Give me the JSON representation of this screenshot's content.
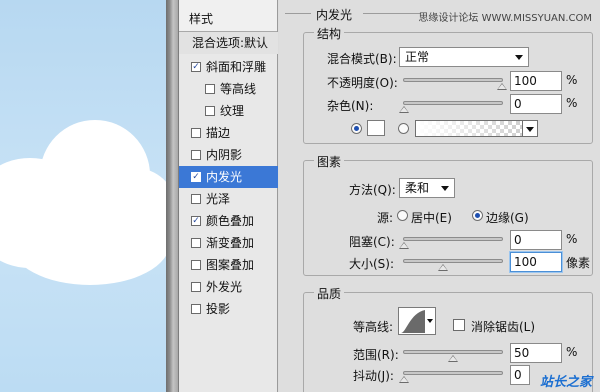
{
  "styles_panel": {
    "header": "样式",
    "blend_options": "混合选项:默认",
    "items": [
      {
        "label": "斜面和浮雕",
        "checked": true,
        "indent": false,
        "selected": false
      },
      {
        "label": "等高线",
        "checked": false,
        "indent": true,
        "selected": false
      },
      {
        "label": "纹理",
        "checked": false,
        "indent": true,
        "selected": false
      },
      {
        "label": "描边",
        "checked": false,
        "indent": false,
        "selected": false
      },
      {
        "label": "内阴影",
        "checked": false,
        "indent": false,
        "selected": false
      },
      {
        "label": "内发光",
        "checked": true,
        "indent": false,
        "selected": true
      },
      {
        "label": "光泽",
        "checked": false,
        "indent": false,
        "selected": false
      },
      {
        "label": "颜色叠加",
        "checked": true,
        "indent": false,
        "selected": false
      },
      {
        "label": "渐变叠加",
        "checked": false,
        "indent": false,
        "selected": false
      },
      {
        "label": "图案叠加",
        "checked": false,
        "indent": false,
        "selected": false
      },
      {
        "label": "外发光",
        "checked": false,
        "indent": false,
        "selected": false
      },
      {
        "label": "投影",
        "checked": false,
        "indent": false,
        "selected": false
      }
    ]
  },
  "panel": {
    "title": "内发光",
    "watermark_top": "思缘设计论坛 WWW.MISSYUAN.COM",
    "structure": {
      "legend": "结构",
      "blend_mode_label": "混合模式(B):",
      "blend_mode_value": "正常",
      "opacity_label": "不透明度(O):",
      "opacity_value": "100",
      "opacity_unit": "%",
      "opacity_level": 1.0,
      "noise_label": "杂色(N):",
      "noise_value": "0",
      "noise_unit": "%",
      "noise_level": 0.0
    },
    "elements": {
      "legend": "图素",
      "method_label": "方法(Q):",
      "method_value": "柔和",
      "source_label": "源:",
      "source_center": "居中(E)",
      "source_edge": "边缘(G)",
      "source_selected": "edge",
      "choke_label": "阻塞(C):",
      "choke_value": "0",
      "choke_unit": "%",
      "choke_level": 0.0,
      "size_label": "大小(S):",
      "size_value": "100",
      "size_unit": "像素",
      "size_level": 0.4
    },
    "quality": {
      "legend": "品质",
      "contour_label": "等高线:",
      "antialias_label": "消除锯齿(L)",
      "antialias_checked": false,
      "range_label": "范围(R):",
      "range_value": "50",
      "range_unit": "%",
      "range_level": 0.5,
      "jitter_label": "抖动(J):",
      "jitter_value": "0",
      "jitter_unit": "%",
      "jitter_level": 0.0
    },
    "watermark_bottom": "站长之家"
  }
}
